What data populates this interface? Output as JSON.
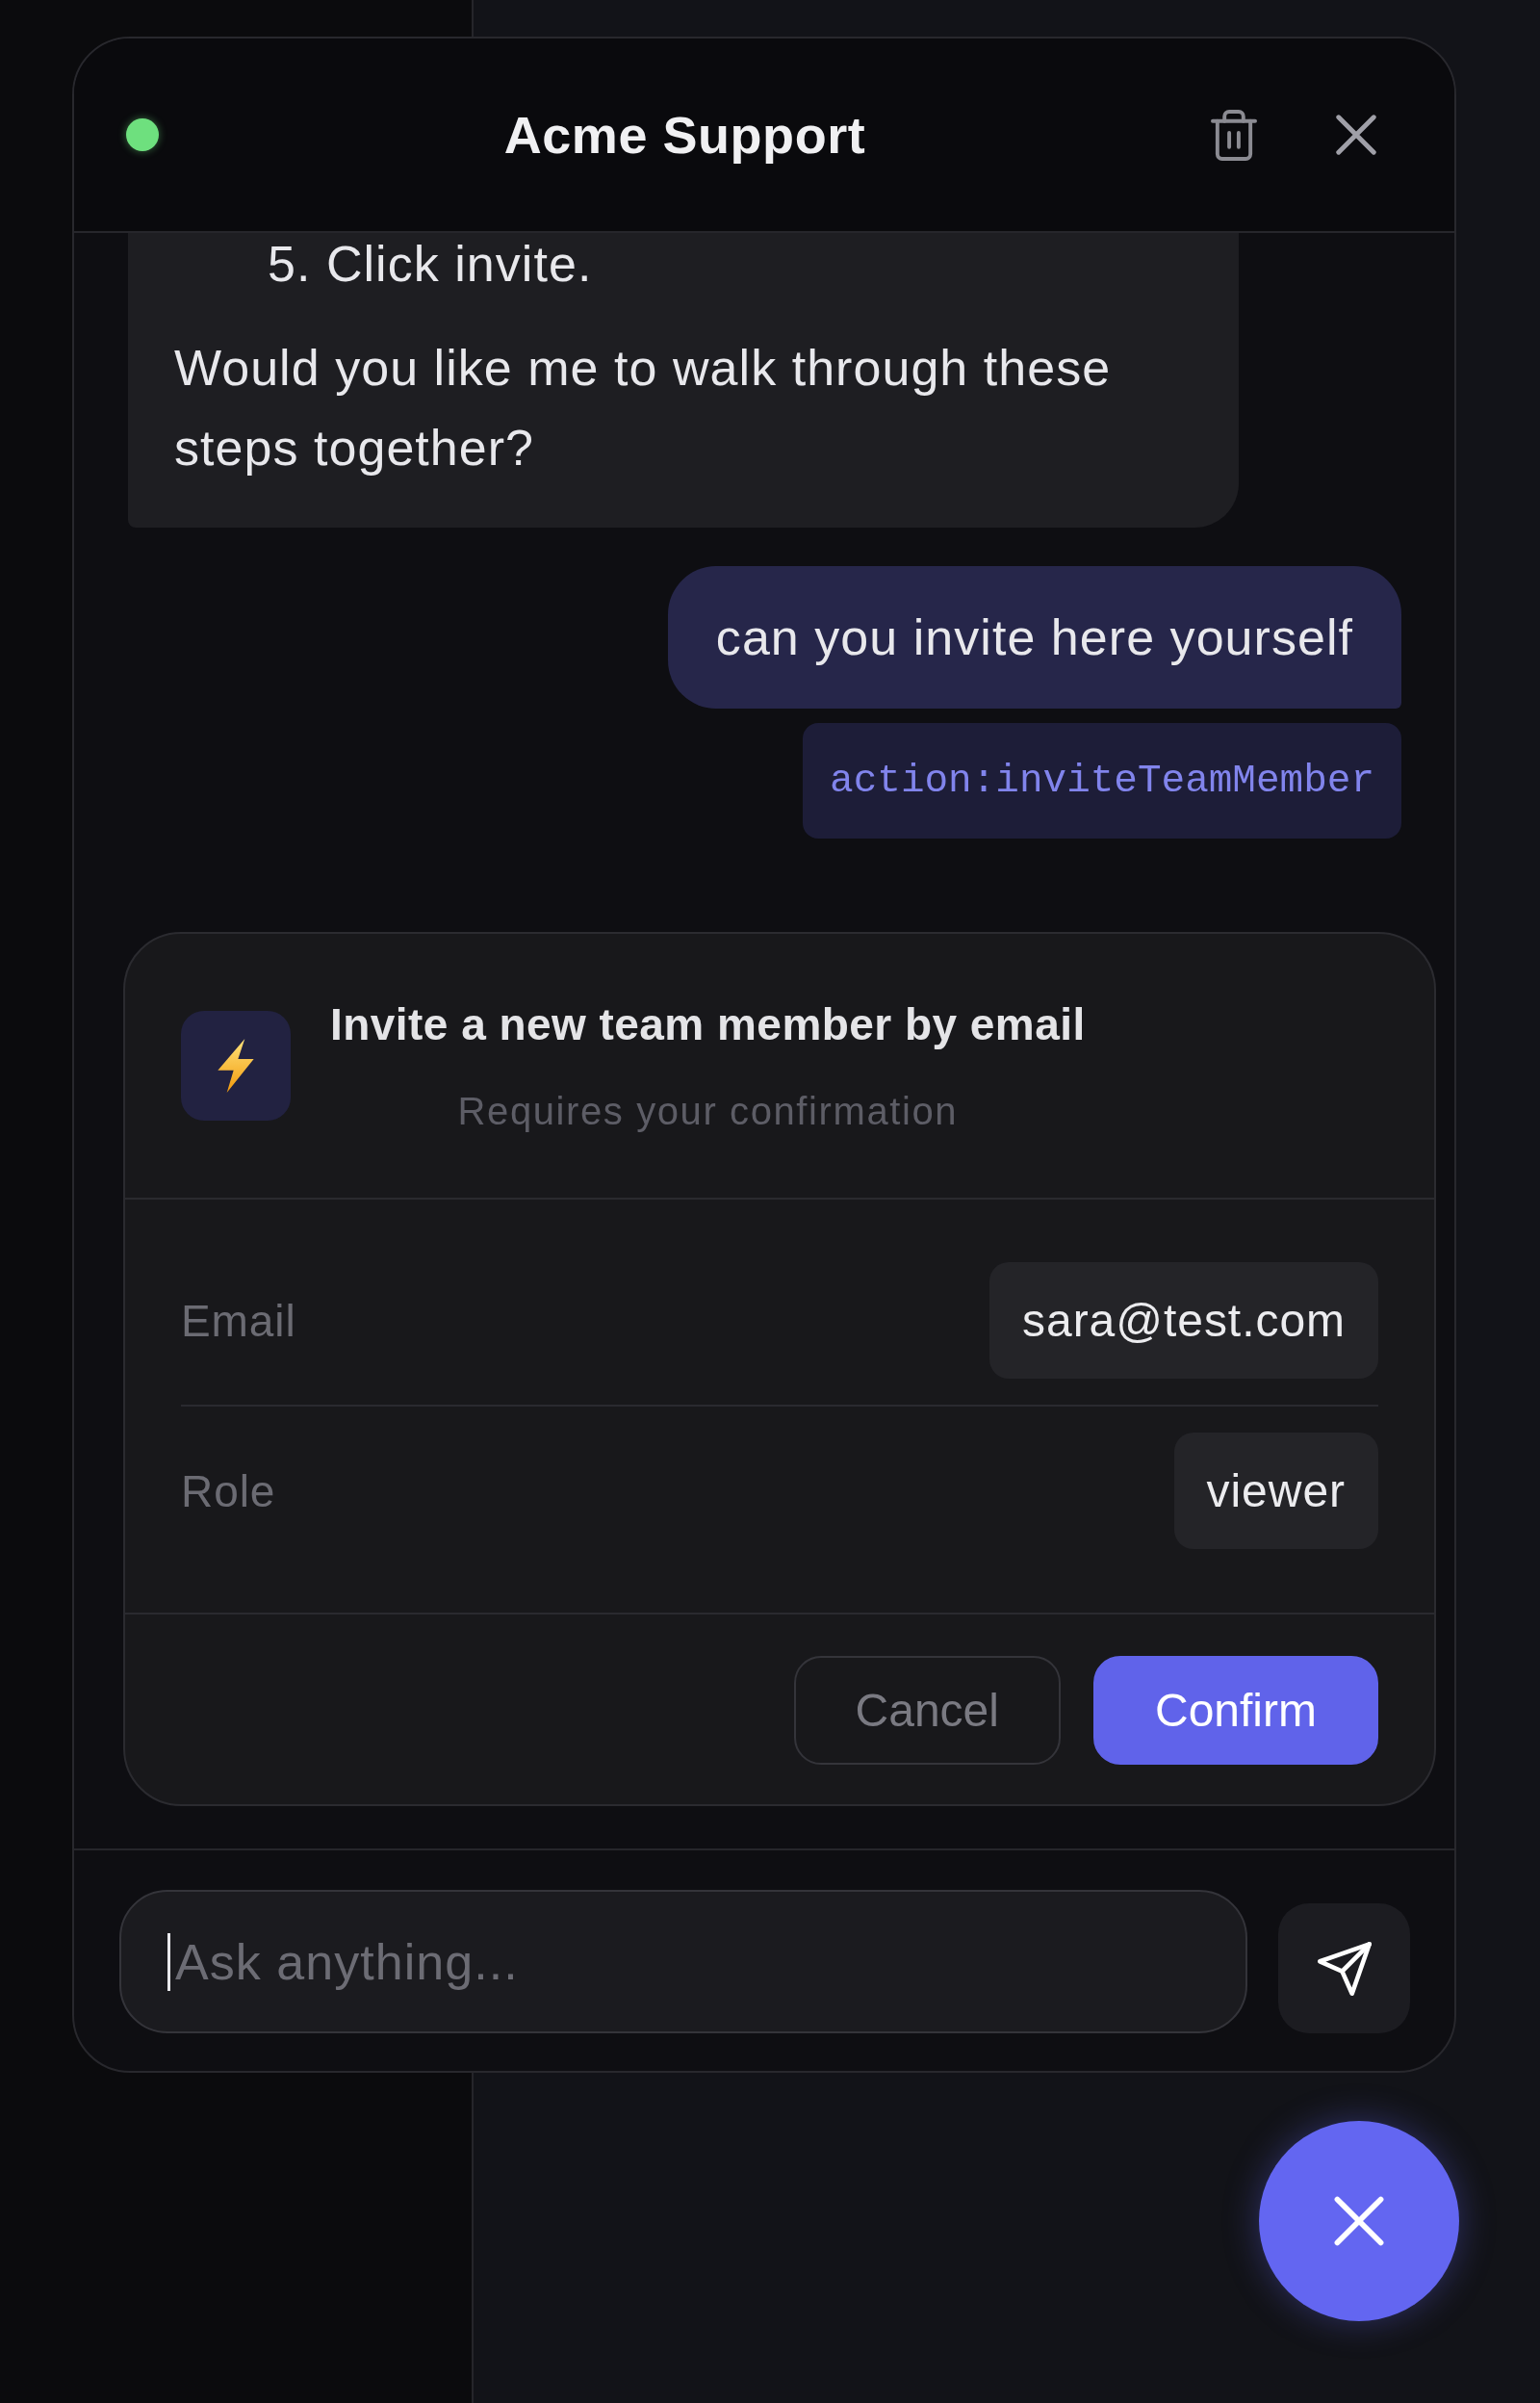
{
  "header": {
    "title": "Acme Support",
    "online": true
  },
  "messages": [
    {
      "kind": "assistant",
      "list_items": [
        "5. Click invite."
      ],
      "text": "Would you like me to walk through these steps together?"
    },
    {
      "kind": "user",
      "text": "can you invite here yourself"
    },
    {
      "kind": "action",
      "text": "action:inviteTeamMember"
    }
  ],
  "action_card": {
    "title": "Invite a new team member by email",
    "subtitle": "Requires your confirmation",
    "fields": [
      {
        "label": "Email",
        "value": "sara@test.com"
      },
      {
        "label": "Role",
        "value": "viewer"
      }
    ],
    "buttons": [
      {
        "kind": "secondary",
        "label": "Cancel"
      },
      {
        "kind": "primary",
        "label": "Confirm"
      }
    ]
  },
  "composer": {
    "placeholder": "Ask anything...",
    "focused": true
  }
}
